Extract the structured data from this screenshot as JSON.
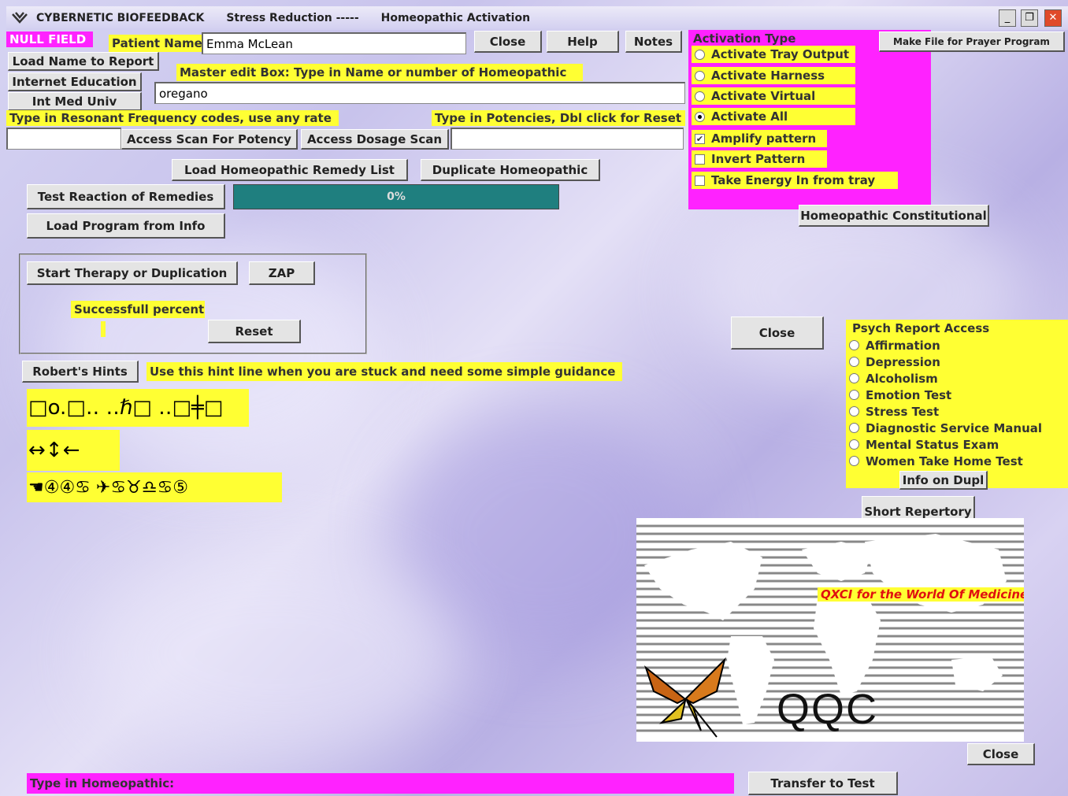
{
  "window": {
    "app_title": "CYBERNETIC BIOFEEDBACK",
    "section_title": "Stress Reduction -----",
    "screen_title": "Homeopathic Activation",
    "minimize_glyph": "_",
    "restore_glyph": "❐",
    "close_glyph": "✕"
  },
  "header": {
    "null_field": "NULL FIELD",
    "patient_name_label": "Patient Name",
    "patient_name_value": "Emma McLean",
    "close_label": "Close",
    "help_label": "Help",
    "notes_label": "Notes"
  },
  "left_buttons": {
    "load_name": "Load Name to Report",
    "internet_education": "Internet Education",
    "int_med_univ": "Int Med Univ"
  },
  "master_edit": {
    "label": "Master edit Box: Type in Name or number of Homeopathic",
    "value": "oregano"
  },
  "codes": {
    "resonant_label": "Type in Resonant Frequency codes, use any rate",
    "potencies_label": "Type in Potencies, Dbl click for Reset",
    "resonant_value": "",
    "potencies_value": "",
    "access_scan_potency": "Access Scan For Potency",
    "access_dosage_scan": "Access Dosage Scan"
  },
  "remedy_buttons": {
    "load_list": "Load Homeopathic Remedy List",
    "duplicate": "Duplicate Homeopathic",
    "test_reaction": "Test Reaction of Remedies",
    "load_program": "Load Program from Info"
  },
  "progress": {
    "text": "0%",
    "value": 0,
    "color": "#1f7f7f"
  },
  "therapy": {
    "start_label": "Start Therapy or Duplication",
    "zap_label": "ZAP",
    "success_label": "Successfull percent",
    "reset_label": "Reset"
  },
  "hints": {
    "button": "Robert's Hints",
    "text": "Use this hint line when you are stuck and need some simple guidance"
  },
  "glyph_rows": {
    "row1": "□o.□‥ ‥ℏ□ ‥□╪□",
    "row2": "↔↕←",
    "row3": "☚④④♋ ✈♋♉♎♋⑤"
  },
  "activation": {
    "title": "Activation Type",
    "make_file": "Make File for Prayer Program",
    "options": [
      {
        "label": "Activate Tray Output",
        "checked": false
      },
      {
        "label": "Activate Harness",
        "checked": false
      },
      {
        "label": "Activate Virtual",
        "checked": false
      },
      {
        "label": "Activate All",
        "checked": true
      }
    ],
    "checks": [
      {
        "label": "Amplify pattern",
        "checked": true
      },
      {
        "label": "Invert Pattern",
        "checked": false
      },
      {
        "label": "Take Energy In from tray",
        "checked": false
      }
    ],
    "constitutional": "Homeopathic Constitutional"
  },
  "mid_close": "Close",
  "psych": {
    "title": "Psych Report Access",
    "items": [
      "Affirmation",
      "Depression",
      "Alcoholism",
      "Emotion Test",
      "Stress Test",
      "Diagnostic Service Manual",
      "Mental Status Exam",
      "Women Take Home Test"
    ],
    "info_dupl": "Info on Dupl"
  },
  "short_repertory": "Short Repertory",
  "logo": {
    "tagline": "QXCI for the World Of Medicine",
    "mark": "QQC"
  },
  "bottom": {
    "homeopathic_label": "Type in Homeopathic:",
    "close_label": "Close",
    "transfer_label": "Transfer to Test"
  },
  "colors": {
    "yellow": "#ffff33",
    "magenta": "#ff22ff",
    "teal": "#1f7f7f"
  }
}
